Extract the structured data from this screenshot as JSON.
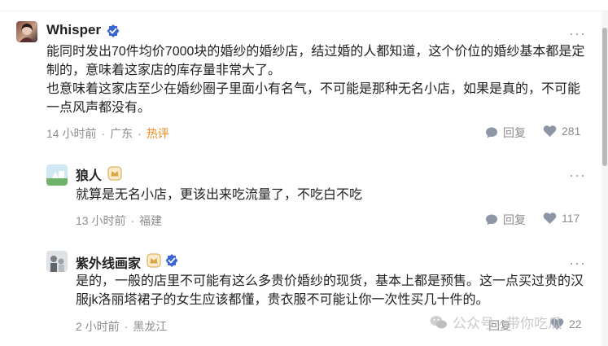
{
  "comments": [
    {
      "author": "Whisper",
      "text_lines": [
        "能同时发出70件均价7000块的婚纱的婚纱店，结过婚的人都知道，这个价位的婚纱基本都是定制的，意味着这家店的库存量非常大了。",
        "也意味着这家店至少在婚纱圈子里面小有名气，不可能是那种无名小店，如果是真的，不可能一点风声都没有。"
      ],
      "time": "14 小时前",
      "location": "广东",
      "tag": "热评",
      "reply_label": "回复",
      "likes": "281"
    },
    {
      "author": "狼人",
      "text_lines": [
        "就算是无名小店，更该出来吃流量了，不吃白不吃"
      ],
      "time": "13 小时前",
      "location": "福建",
      "reply_label": "回复",
      "likes": "117"
    },
    {
      "author": "紫外线画家",
      "text_lines": [
        "是的，一般的店里不可能有这么多贵价婚纱的现货，基本上都是预售。这一点买过贵的汉服jk洛丽塔裙子的女生应该都懂，贵衣服不可能让你一次性买几十件的。"
      ],
      "time": "2 小时前",
      "location": "黑龙江",
      "reply_label": "回复",
      "likes": "22"
    }
  ],
  "more_glyph": "···",
  "watermark": "公众号 · 带你吃瓜",
  "colors": {
    "hot_tag": "#f0881a",
    "verified_badge": "#3a66d6",
    "level_badge": "#d9a441",
    "meta_text": "#8c8c8c"
  },
  "icons": [
    "more-icon",
    "verified-badge-icon",
    "level-badge-icon",
    "reply-icon",
    "like-icon",
    "wechat-icon"
  ]
}
